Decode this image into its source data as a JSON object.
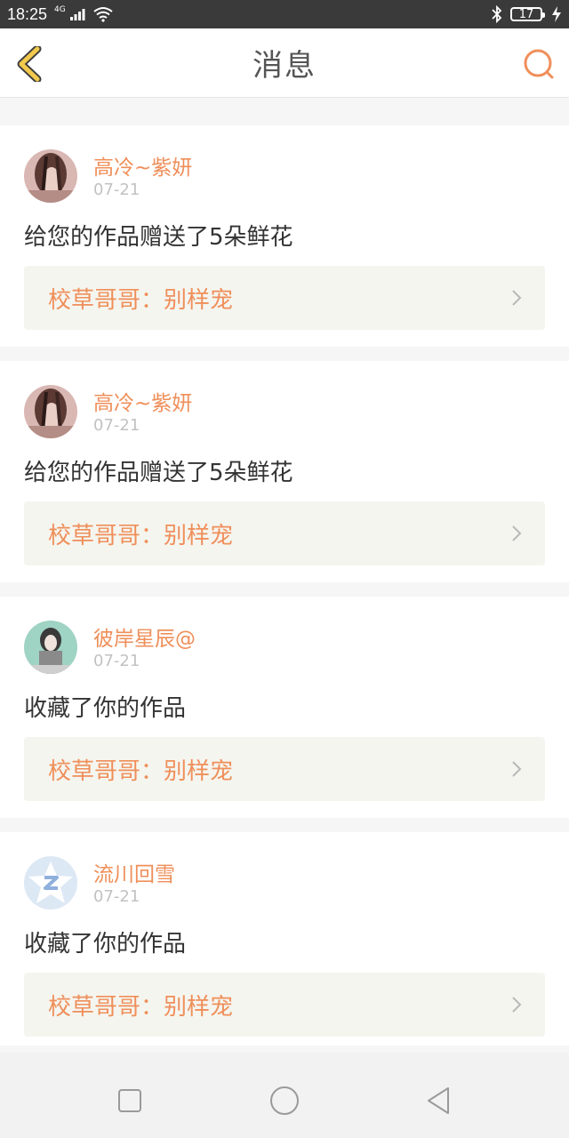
{
  "status_bar": {
    "time": "18:25",
    "network": "4G",
    "battery": "17",
    "icons": [
      "signal-icon",
      "wifi-icon",
      "bluetooth-icon",
      "battery-icon",
      "charging-icon"
    ]
  },
  "header": {
    "title": "消息",
    "back_icon": "chevron-left-icon",
    "search_icon": "search-icon"
  },
  "messages": [
    {
      "name": "高冷~紫妍",
      "date": "07-21",
      "text": "给您的作品赠送了5朵鲜花",
      "work": "校草哥哥：别样宠"
    },
    {
      "name": "高冷~紫妍",
      "date": "07-21",
      "text": "给您的作品赠送了5朵鲜花",
      "work": "校草哥哥：别样宠"
    },
    {
      "name": "彼岸星辰@",
      "date": "07-21",
      "text": "收藏了你的作品",
      "work": "校草哥哥：别样宠"
    },
    {
      "name": "流川回雪",
      "date": "07-21",
      "text": "收藏了你的作品",
      "work": "校草哥哥：别样宠"
    }
  ],
  "colors": {
    "accent": "#ef8f5a",
    "back_icon": "#f2c94c"
  },
  "nav_icons": [
    "recent-apps-icon",
    "home-icon",
    "back-triangle-icon"
  ]
}
